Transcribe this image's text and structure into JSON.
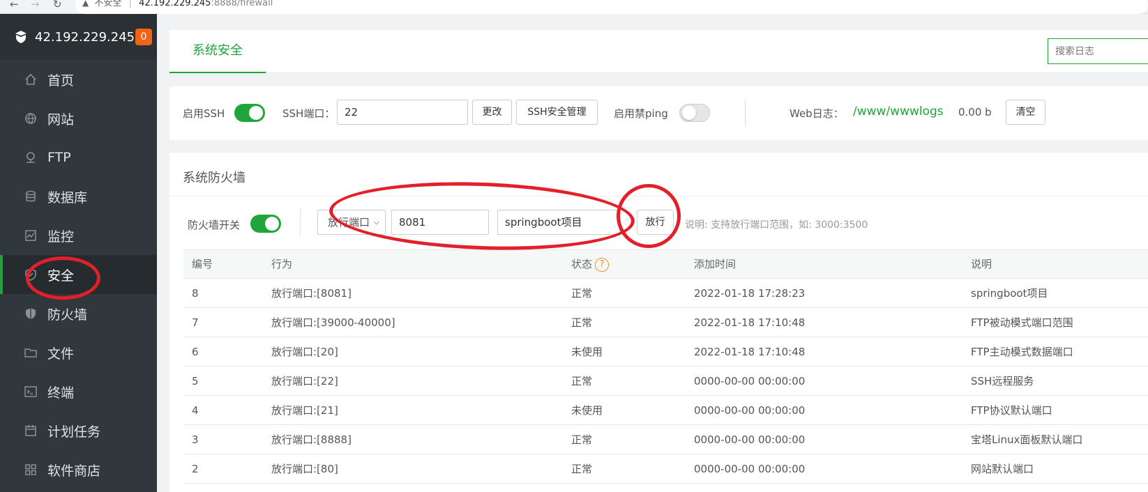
{
  "browser": {
    "back": "←",
    "forward": "→",
    "reload": "↻",
    "security": "不安全",
    "host": "42.192.229.245",
    "path": ":8888/firewall"
  },
  "sidebar": {
    "server_ip": "42.192.229.245",
    "badge": "0",
    "items": [
      {
        "label": "首页",
        "icon": "home-icon"
      },
      {
        "label": "网站",
        "icon": "globe-icon"
      },
      {
        "label": "FTP",
        "icon": "ftp-icon"
      },
      {
        "label": "数据库",
        "icon": "database-icon"
      },
      {
        "label": "监控",
        "icon": "monitor-icon"
      },
      {
        "label": "安全",
        "icon": "shield-icon",
        "active": true
      },
      {
        "label": "防火墙",
        "icon": "firewall-icon"
      },
      {
        "label": "文件",
        "icon": "folder-icon"
      },
      {
        "label": "终端",
        "icon": "terminal-icon"
      },
      {
        "label": "计划任务",
        "icon": "calendar-icon"
      },
      {
        "label": "软件商店",
        "icon": "grid-icon"
      }
    ]
  },
  "tabs": {
    "active": "系统安全",
    "log_search_placeholder": "搜索日志"
  },
  "ssh": {
    "enable_label": "启用SSH",
    "enabled": true,
    "port_label": "SSH端口：",
    "port_value": "22",
    "change_btn": "更改",
    "manage_btn": "SSH安全管理",
    "ping_label": "启用禁ping",
    "ping_enabled": false,
    "weblog_label": "Web日志：",
    "weblog_path": "/www/wwwlogs",
    "weblog_size": "0.00 b",
    "clear_btn": "清空"
  },
  "firewall": {
    "title": "系统防火墙",
    "switch_label": "防火墙开关",
    "switch_on": true,
    "action_select": "放行端口",
    "port_input": "8081",
    "desc_input": "springboot项目",
    "allow_btn": "放行",
    "hint": "说明: 支持放行端口范围，如: 3000:3500",
    "columns": [
      "编号",
      "行为",
      "状态",
      "添加时间",
      "说明"
    ],
    "rows": [
      {
        "id": "8",
        "action": "放行端口:[8081]",
        "status": "正常",
        "time": "2022-01-18 17:28:23",
        "note": "springboot项目"
      },
      {
        "id": "7",
        "action": "放行端口:[39000-40000]",
        "status": "正常",
        "time": "2022-01-18 17:10:48",
        "note": "FTP被动模式端口范围"
      },
      {
        "id": "6",
        "action": "放行端口:[20]",
        "status": "未使用",
        "time": "2022-01-18 17:10:48",
        "note": "FTP主动模式数据端口"
      },
      {
        "id": "5",
        "action": "放行端口:[22]",
        "status": "正常",
        "time": "0000-00-00 00:00:00",
        "note": "SSH远程服务"
      },
      {
        "id": "4",
        "action": "放行端口:[21]",
        "status": "未使用",
        "time": "0000-00-00 00:00:00",
        "note": "FTP协议默认端口"
      },
      {
        "id": "3",
        "action": "放行端口:[8888]",
        "status": "正常",
        "time": "0000-00-00 00:00:00",
        "note": "宝塔Linux面板默认端口"
      },
      {
        "id": "2",
        "action": "放行端口:[80]",
        "status": "正常",
        "time": "0000-00-00 00:00:00",
        "note": "网站默认端口"
      }
    ]
  },
  "colors": {
    "brand_green": "#20a53a",
    "sidebar_bg": "#30373d",
    "annotation_red": "#e3202a",
    "badge_orange": "#f0641a"
  }
}
